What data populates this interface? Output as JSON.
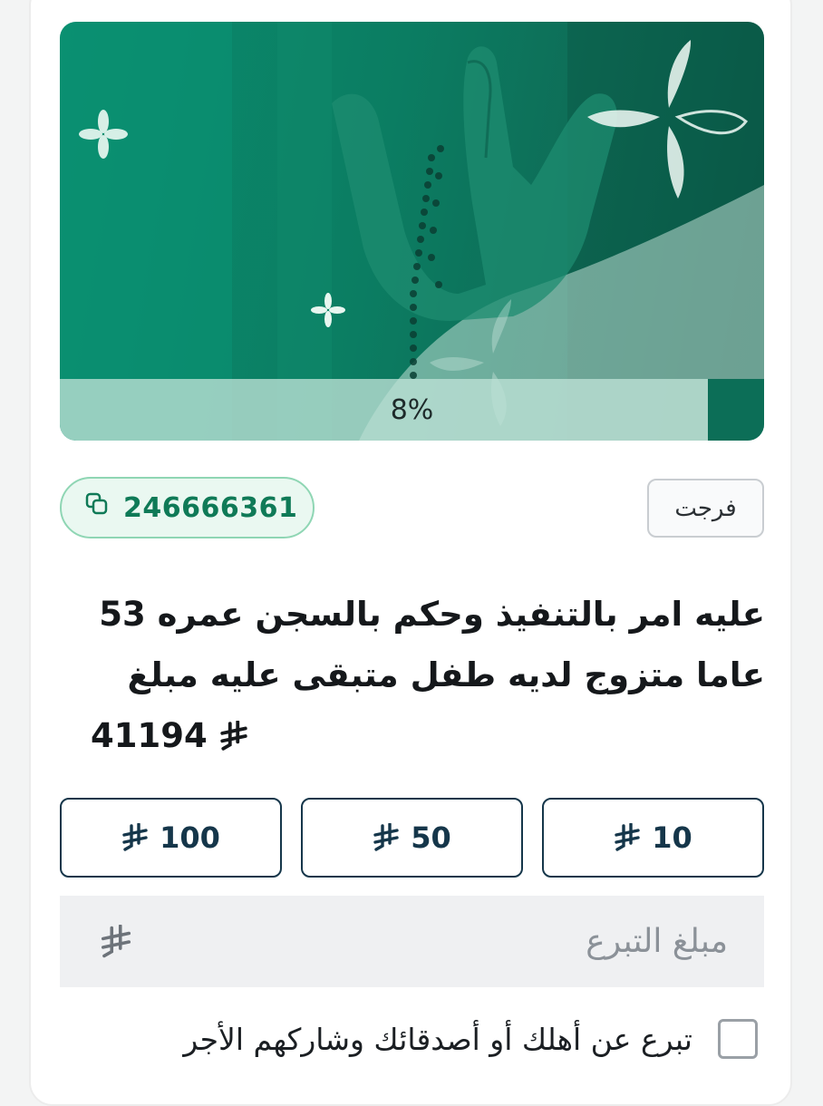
{
  "campaign": {
    "progress_label": "8%",
    "progress_fraction": 0.08,
    "category_tag": "فرجت",
    "case_id": "246666361",
    "title_line1": "عليه امر بالتنفيذ وحكم بالسجن عمره 53",
    "title_line2": "عاما متزوج لديه طفل متبقى عليه مبلغ",
    "title_amount": "41194"
  },
  "quick_amounts": [
    {
      "value": "10"
    },
    {
      "value": "50"
    },
    {
      "value": "100"
    }
  ],
  "donation_input": {
    "placeholder": "مبلغ التبرع"
  },
  "gift_option": {
    "label": "تبرع عن أهلك أو أصدقائك وشاركهم الأجر",
    "checked": false
  },
  "icons": {
    "currency": "saudi-riyal-icon",
    "copy": "copy-icon"
  },
  "colors": {
    "brand_green": "#0a8c6e",
    "dark_green": "#0c6e57",
    "navy": "#15364a",
    "id_green": "#0f7a57"
  }
}
